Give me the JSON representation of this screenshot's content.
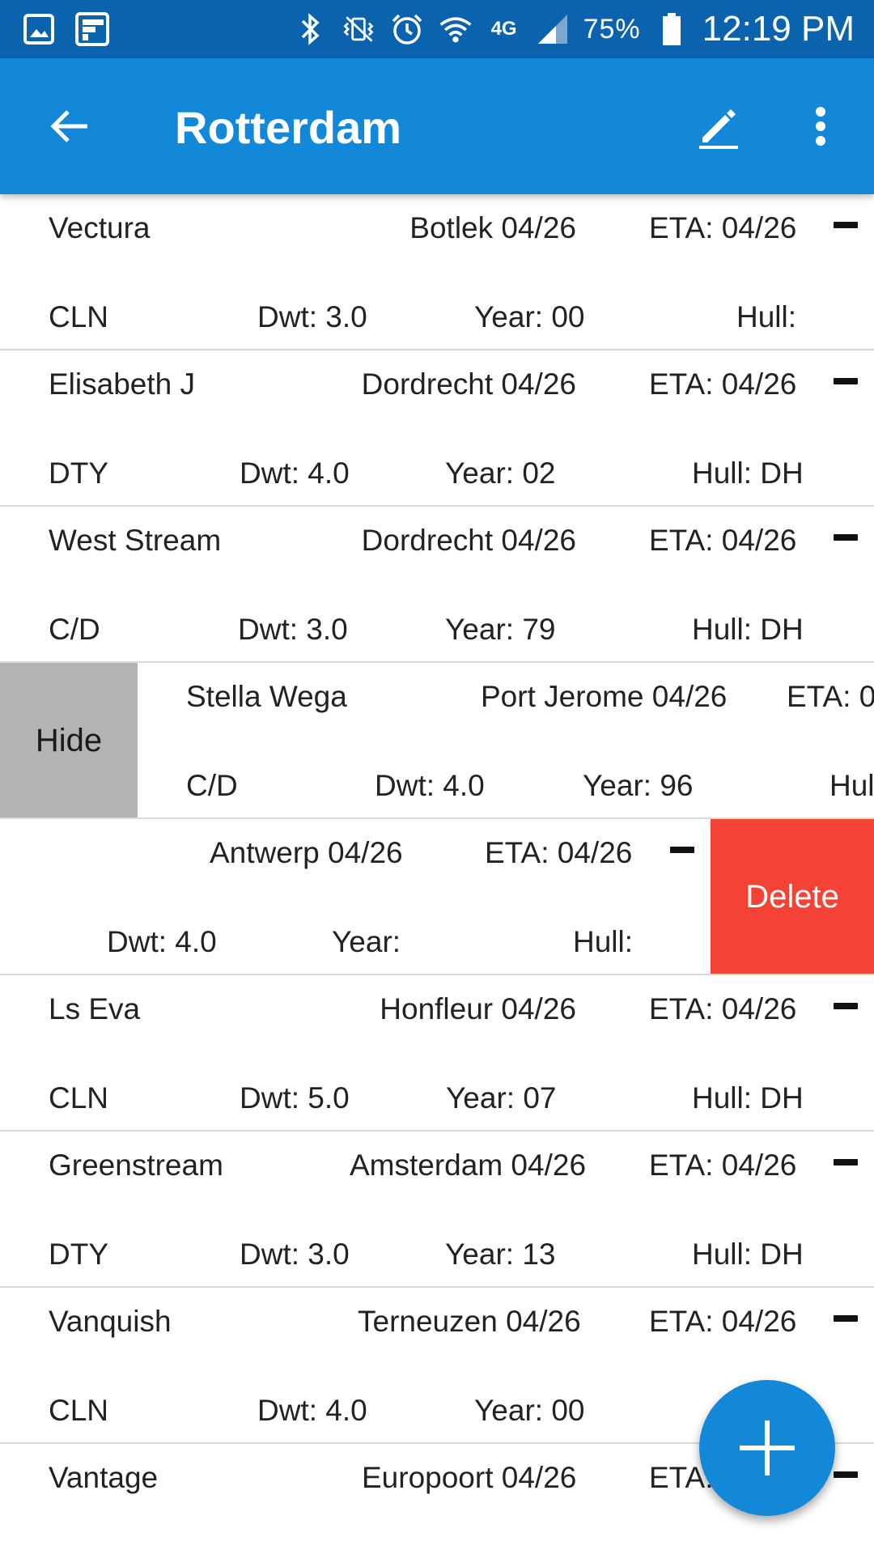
{
  "status_bar": {
    "battery": "75%",
    "time": "12:19 PM",
    "network": "4G",
    "icons": [
      "gallery-icon",
      "flipboard-icon",
      "bluetooth-icon",
      "vibrate-mute-icon",
      "alarm-icon",
      "wifi-icon",
      "lte-icon",
      "signal-icon",
      "battery-icon"
    ]
  },
  "appbar": {
    "title": "Rotterdam",
    "icons": [
      "back-arrow-icon",
      "edit-pencil-icon",
      "more-vert-icon"
    ]
  },
  "rows": [
    {
      "name": "Vectura",
      "port": "Botlek  04/26",
      "eta": "ETA: 04/26",
      "type": "CLN",
      "dwt": "Dwt: 3.0",
      "year": "Year: 00",
      "hull": "Hull:"
    },
    {
      "name": "Elisabeth J",
      "port": "Dordrecht  04/26",
      "eta": "ETA: 04/26",
      "type": "DTY",
      "dwt": "Dwt: 4.0",
      "year": "Year: 02",
      "hull": "Hull: DH"
    },
    {
      "name": "West Stream",
      "port": "Dordrecht  04/26",
      "eta": "ETA: 04/26",
      "type": "C/D",
      "dwt": "Dwt: 3.0",
      "year": "Year: 79",
      "hull": "Hull: DH"
    },
    {
      "name": "Stella Wega",
      "port": "Port Jerome  04/26",
      "eta": "ETA: 0",
      "type": "C/D",
      "dwt": "Dwt: 4.0",
      "year": "Year: 96",
      "hull": "Hul",
      "action": "Hide"
    },
    {
      "name": "",
      "port": "Antwerp  04/26",
      "eta": "ETA: 04/26",
      "type": "",
      "dwt": "Dwt: 4.0",
      "year": "Year:",
      "hull": "Hull:",
      "action": "Delete"
    },
    {
      "name": "Ls Eva",
      "port": "Honfleur  04/26",
      "eta": "ETA: 04/26",
      "type": "CLN",
      "dwt": "Dwt: 5.0",
      "year": "Year: 07",
      "hull": "Hull: DH"
    },
    {
      "name": "Greenstream",
      "port": "Amsterdam  04/26",
      "eta": "ETA: 04/26",
      "type": "DTY",
      "dwt": "Dwt: 3.0",
      "year": "Year: 13",
      "hull": "Hull: DH"
    },
    {
      "name": "Vanquish",
      "port": "Terneuzen  04/26",
      "eta": "ETA: 04/26",
      "type": "CLN",
      "dwt": "Dwt: 4.0",
      "year": "Year: 00",
      "hull": ""
    },
    {
      "name": "Vantage",
      "port": "Europoort  04/26",
      "eta": "ETA:",
      "type": "",
      "dwt": "",
      "year": "",
      "hull": ""
    }
  ],
  "fab": {
    "icon": "add-icon"
  },
  "colors": {
    "appbar": "#1488d8",
    "statusbar": "#0b63ad",
    "hide": "#b3b3b3",
    "delete": "#f44336"
  }
}
